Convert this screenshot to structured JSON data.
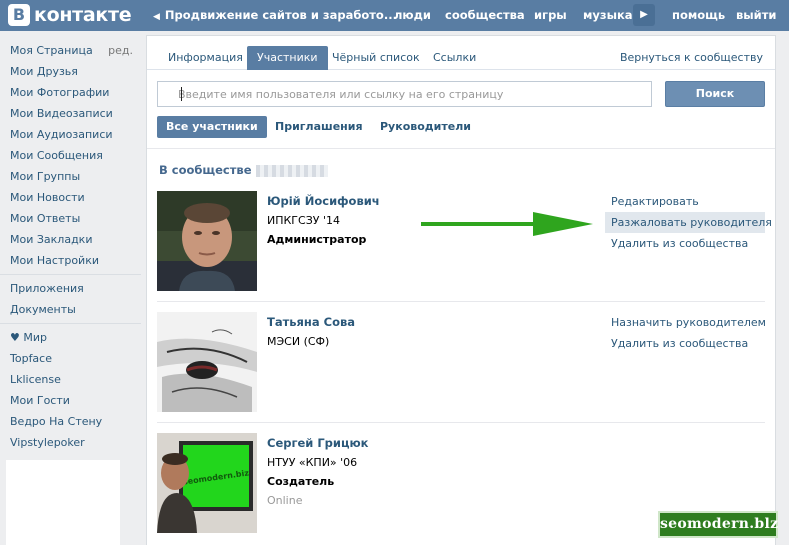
{
  "topbar": {
    "logo_letter": "В",
    "logo_text": "контакте",
    "title": "Продвижение сайтов и заработо...",
    "links": [
      "люди",
      "сообщества",
      "игры",
      "музыка",
      "помощь",
      "выйти"
    ],
    "brand_color": "#597da3"
  },
  "left_menu": {
    "edit_label": "ред.",
    "group1": [
      "Моя Страница",
      "Мои Друзья",
      "Мои Фотографии",
      "Мои Видеозаписи",
      "Мои Аудиозаписи",
      "Мои Сообщения",
      "Мои Группы",
      "Мои Новости",
      "Мои Ответы",
      "Мои Закладки",
      "Мои Настройки"
    ],
    "group2": [
      "Приложения",
      "Документы"
    ],
    "group3": [
      "♥ Мир",
      "Topface",
      "Lklicense",
      "Мои Гости",
      "Ведро На Стену",
      "Vipstylepoker"
    ]
  },
  "tabs": {
    "items": [
      "Информация",
      "Участники",
      "Чёрный список",
      "Ссылки"
    ],
    "active": "Участники",
    "back_label": "Вернуться к сообществу"
  },
  "search": {
    "placeholder": "Введите имя пользователя или ссылку на его страницу",
    "button_label": "Поиск"
  },
  "filters": {
    "items": [
      "Все участники",
      "Приглашения",
      "Руководители"
    ],
    "active": "Все участники"
  },
  "section_title": "В сообществе",
  "members": [
    {
      "name": "Юрій Йосифович",
      "sub": "ИПКГСЗУ '14",
      "role": "Администратор",
      "actions": [
        "Редактировать",
        "Разжаловать руководителя",
        "Удалить из сообщества"
      ]
    },
    {
      "name": "Татьяна Сова",
      "sub": "МЭСИ (СФ)",
      "actions": [
        "Назначить руководителем",
        "Удалить из сообщества"
      ]
    },
    {
      "name": "Сергей Грицюк",
      "sub": "НТУУ «КПИ» '06",
      "role": "Создатель",
      "status": "Online"
    }
  ],
  "avatar3_screen_text": "seomodern.biz",
  "watermark": "seomodern.blz",
  "colors": {
    "link": "#2b587a",
    "highlight_row": "#e1e7ed",
    "arrow": "#2fa51e"
  }
}
